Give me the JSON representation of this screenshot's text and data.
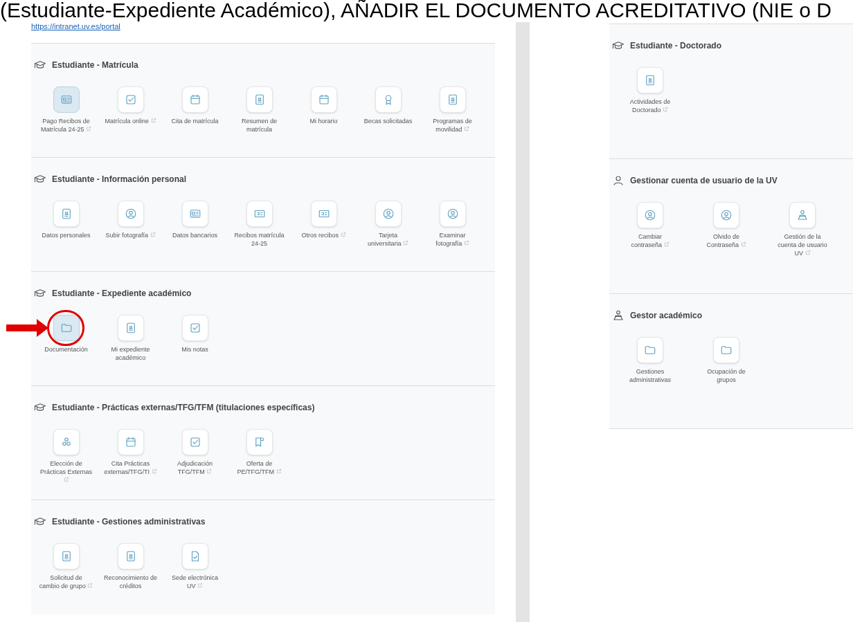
{
  "heading": "(Estudiante-Expediente Académico), AÑADIR EL DOCUMENTO ACREDITATIVO (NIE o D",
  "link": "https://intranet.uv.es/portal",
  "left_panel": [
    {
      "title": "Estudiante - Matrícula",
      "kind": "cap",
      "items": [
        {
          "label": "Pago Recibos de Matrícula 24-25",
          "kind": "card",
          "external": true,
          "selected": true,
          "annotated": false
        },
        {
          "label": "Matrícula online",
          "kind": "check",
          "external": true,
          "selected": false,
          "annotated": false
        },
        {
          "label": "Cita de matrícula",
          "kind": "calendar",
          "external": false,
          "selected": false,
          "annotated": false
        },
        {
          "label": "Resumen de matrícula",
          "kind": "doc",
          "external": false,
          "selected": false,
          "annotated": false
        },
        {
          "label": "Mi horario",
          "kind": "calendar",
          "external": false,
          "selected": false,
          "annotated": false
        },
        {
          "label": "Becas solicitadas",
          "kind": "award",
          "external": false,
          "selected": false,
          "annotated": false
        },
        {
          "label": "Programas de movilidad",
          "kind": "doc",
          "external": true,
          "selected": false,
          "annotated": false
        }
      ]
    },
    {
      "title": "Estudiante - Información personal",
      "kind": "cap",
      "items": [
        {
          "label": "Datos personales",
          "kind": "doc",
          "external": false,
          "selected": false,
          "annotated": false
        },
        {
          "label": "Subir fotografía",
          "kind": "user",
          "external": true,
          "selected": false,
          "annotated": false
        },
        {
          "label": "Datos bancarios",
          "kind": "card",
          "external": false,
          "selected": false,
          "annotated": false
        },
        {
          "label": "Recibos matrícula 24-25",
          "kind": "ticket",
          "external": false,
          "selected": false,
          "annotated": false
        },
        {
          "label": "Otros recibos",
          "kind": "ticket",
          "external": true,
          "selected": false,
          "annotated": false
        },
        {
          "label": "Tarjeta universitaria",
          "kind": "user",
          "external": true,
          "selected": false,
          "annotated": false
        },
        {
          "label": "Examinar fotografía",
          "kind": "user",
          "external": true,
          "selected": false,
          "annotated": false
        }
      ]
    },
    {
      "title": "Estudiante - Expediente académico",
      "kind": "cap",
      "items": [
        {
          "label": "Documentación",
          "kind": "folder",
          "external": false,
          "selected": true,
          "annotated": true
        },
        {
          "label": "Mi expediente académico",
          "kind": "doc",
          "external": false,
          "selected": false,
          "annotated": false
        },
        {
          "label": "Mis notas",
          "kind": "check",
          "external": false,
          "selected": false,
          "annotated": false
        }
      ]
    },
    {
      "title": "Estudiante - Prácticas externas/TFG/TFM (titulaciones específicas)",
      "kind": "cap",
      "items": [
        {
          "label": "Elección de Prácticas Externas",
          "kind": "people",
          "external": true,
          "selected": false,
          "annotated": false
        },
        {
          "label": "Cita Prácticas externas/TFG/TI",
          "kind": "calendar",
          "external": true,
          "selected": false,
          "annotated": false
        },
        {
          "label": "Adjudicación TFG/TFM",
          "kind": "check",
          "external": true,
          "selected": false,
          "annotated": false
        },
        {
          "label": "Oferta de PE/TFG/TFM",
          "kind": "bookmark",
          "external": true,
          "selected": false,
          "annotated": false
        }
      ]
    },
    {
      "title": "Estudiante - Gestiones administrativas",
      "kind": "cap",
      "items": [
        {
          "label": "Solicitud de cambio de grupo",
          "kind": "doc",
          "external": true,
          "selected": false,
          "annotated": false
        },
        {
          "label": "Reconocimiento de créditos",
          "kind": "doc",
          "external": false,
          "selected": false,
          "annotated": false
        },
        {
          "label": "Sede electrónica UV",
          "kind": "filecheck",
          "external": true,
          "selected": false,
          "annotated": false
        }
      ]
    }
  ],
  "right_panel": [
    {
      "title": "Estudiante - Doctorado",
      "kind": "cap",
      "items": [
        {
          "label": "Actividades de Doctorado",
          "kind": "doc",
          "external": true,
          "selected": false,
          "annotated": false
        }
      ]
    },
    {
      "title": "Gestionar cuenta de usuario de la UV",
      "kind": "person",
      "items": [
        {
          "label": "Cambiar contraseña",
          "kind": "user",
          "external": true,
          "selected": false,
          "annotated": false
        },
        {
          "label": "Olvido de Contraseña",
          "kind": "user",
          "external": true,
          "selected": false,
          "annotated": false
        },
        {
          "label": "Gestión de la cuenta de usuario UV",
          "kind": "manager",
          "external": true,
          "selected": false,
          "annotated": false
        }
      ]
    },
    {
      "title": "Gestor académico",
      "kind": "manager",
      "items": [
        {
          "label": "Gestiones administrativas",
          "kind": "folder",
          "external": false,
          "selected": false,
          "annotated": false
        },
        {
          "label": "Ocupación de grupos",
          "kind": "folder",
          "external": false,
          "selected": false,
          "annotated": false
        }
      ]
    }
  ]
}
